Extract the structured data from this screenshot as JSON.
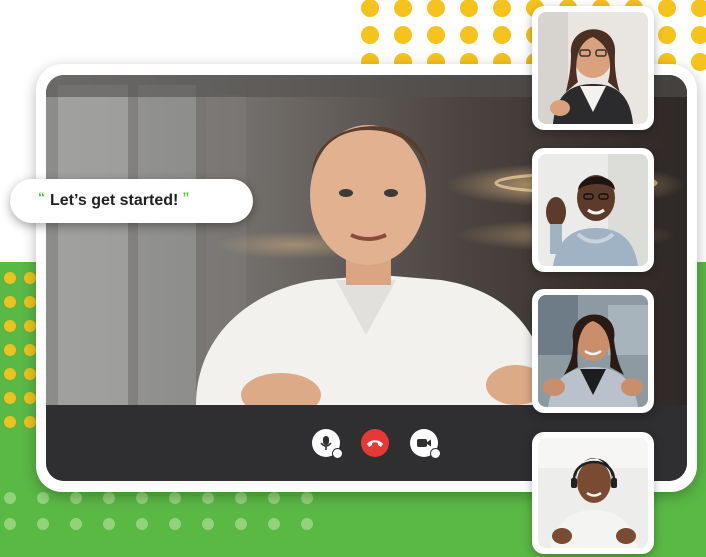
{
  "speech_bubble": {
    "quote_open": "“",
    "text": "Let’s get started!",
    "quote_close": "”"
  },
  "main_speaker": {
    "description_icon": "presenter-video-feed"
  },
  "controls": [
    {
      "name": "microphone",
      "icon": "mic-icon",
      "color": "#ffffff"
    },
    {
      "name": "end-call",
      "icon": "phone-hangup-icon",
      "color": "#e53935"
    },
    {
      "name": "camera",
      "icon": "video-camera-icon",
      "color": "#ffffff"
    }
  ],
  "participants": [
    {
      "icon": "participant-video-thumbnail"
    },
    {
      "icon": "participant-video-thumbnail"
    },
    {
      "icon": "participant-video-thumbnail"
    },
    {
      "icon": "participant-video-thumbnail"
    }
  ],
  "colors": {
    "brand_green": "#5ab845",
    "dot_yellow": "#f6c21c",
    "end_call_red": "#e53935",
    "control_bar": "#2f2f31"
  }
}
